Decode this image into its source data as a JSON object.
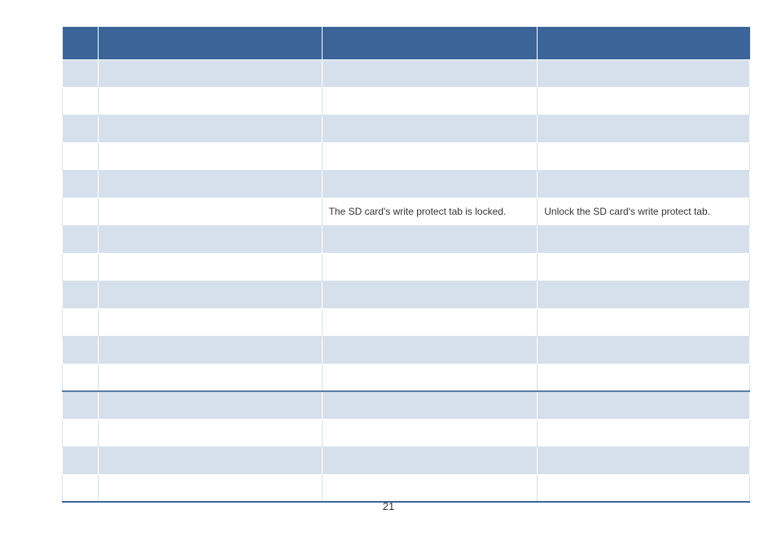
{
  "table": {
    "rows": [
      {
        "c1": "",
        "c2": "",
        "c3": "",
        "c4": ""
      },
      {
        "c1": "",
        "c2": "",
        "c3": "",
        "c4": ""
      },
      {
        "c1": "",
        "c2": "",
        "c3": "",
        "c4": ""
      },
      {
        "c1": "",
        "c2": "",
        "c3": "",
        "c4": ""
      },
      {
        "c1": "",
        "c2": "",
        "c3": "",
        "c4": ""
      },
      {
        "c1": "",
        "c2": "",
        "c3": "The SD card's write protect tab is locked.",
        "c4": "Unlock the SD card's write protect tab."
      },
      {
        "c1": "",
        "c2": "",
        "c3": "",
        "c4": ""
      },
      {
        "c1": "",
        "c2": "",
        "c3": "",
        "c4": ""
      },
      {
        "c1": "",
        "c2": "",
        "c3": "",
        "c4": ""
      },
      {
        "c1": "",
        "c2": "",
        "c3": "",
        "c4": ""
      },
      {
        "c1": "",
        "c2": "",
        "c3": "",
        "c4": ""
      },
      {
        "c1": "",
        "c2": "",
        "c3": "",
        "c4": ""
      },
      {
        "c1": "",
        "c2": "",
        "c3": "",
        "c4": ""
      },
      {
        "c1": "",
        "c2": "",
        "c3": "",
        "c4": ""
      },
      {
        "c1": "",
        "c2": "",
        "c3": "",
        "c4": ""
      },
      {
        "c1": "",
        "c2": "",
        "c3": "",
        "c4": ""
      }
    ]
  },
  "page_number": "21"
}
